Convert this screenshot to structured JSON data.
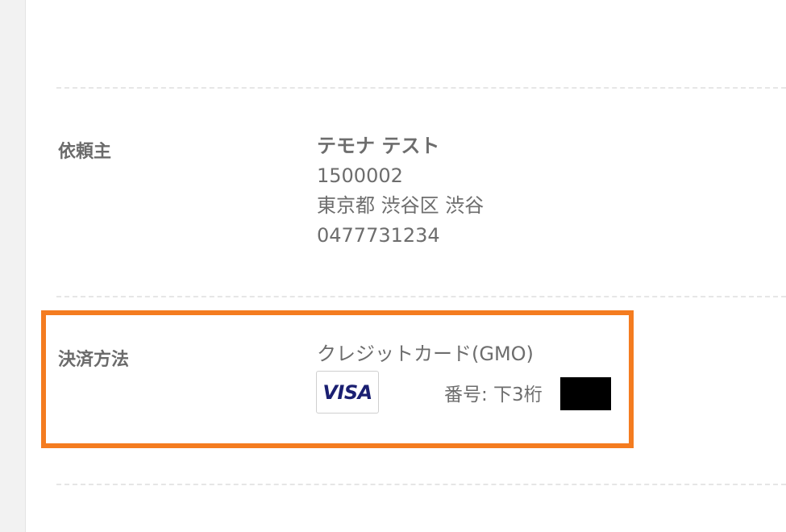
{
  "requester": {
    "label": "依頼主",
    "name": "テモナ テスト",
    "postal_code": "1500002",
    "address": "東京都 渋谷区 渋谷",
    "phone": "0477731234"
  },
  "payment": {
    "label": "決済方法",
    "method": "クレジットカード(GMO)",
    "card_brand": "VISA",
    "card_brand_icon": "visa-card-icon",
    "card_number_label": "番号: 下3桁",
    "card_number_redacted": true
  },
  "colors": {
    "highlight_border": "#f47c20",
    "visa_blue": "#1a1f71",
    "text": "#6d6d6d"
  }
}
